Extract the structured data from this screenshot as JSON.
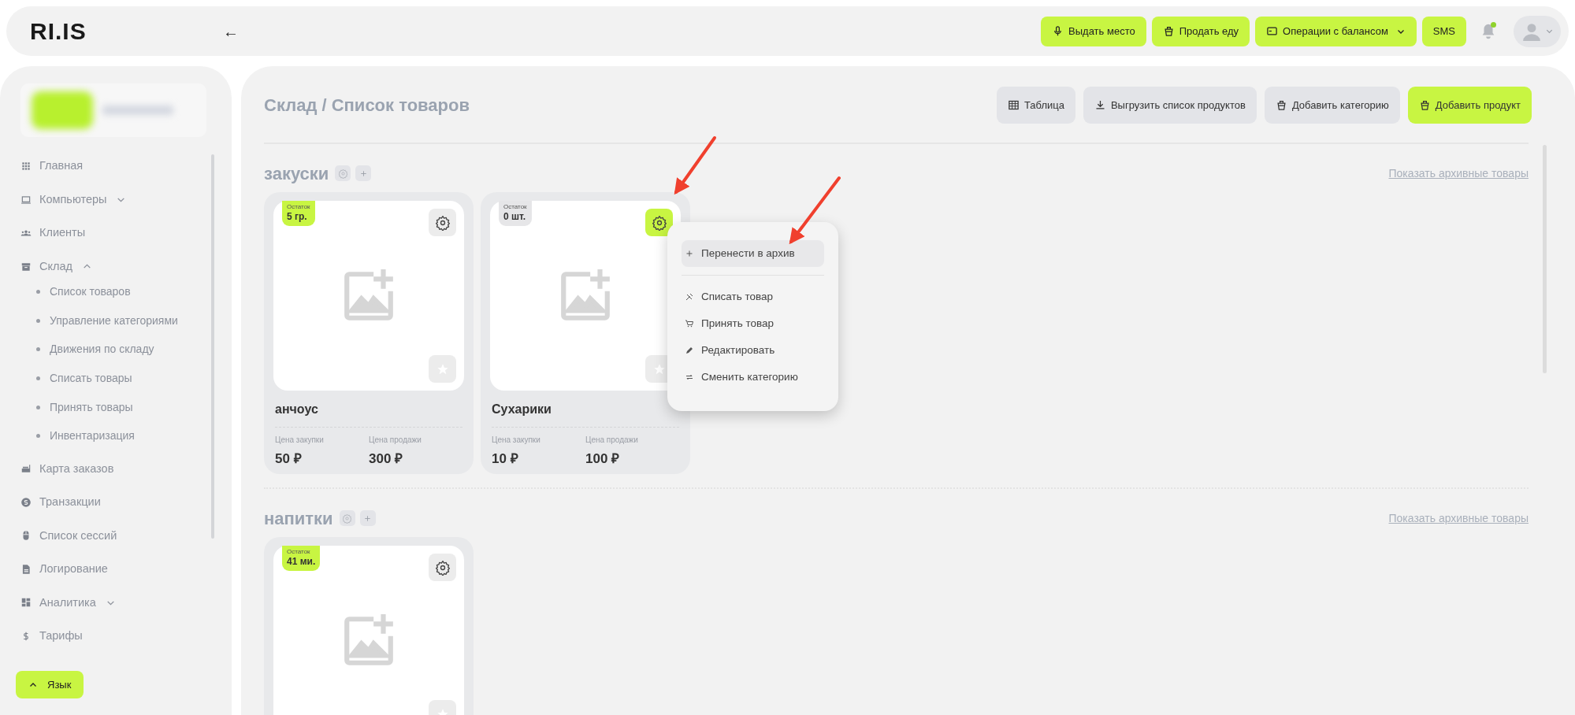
{
  "topbar": {
    "logo": "RI.IS",
    "back": "←",
    "actions": [
      {
        "label": "Выдать место",
        "kind": "mic",
        "caret": false
      },
      {
        "label": "Продать еду",
        "kind": "cup",
        "caret": false
      },
      {
        "label": "Операции с балансом",
        "kind": "card",
        "caret": true
      },
      {
        "label": "SMS",
        "kind": "text",
        "caret": false
      }
    ],
    "has_notification": true
  },
  "sidebar": {
    "nav": [
      {
        "label": "Главная",
        "kind": "grid"
      },
      {
        "label": "Компьютеры",
        "kind": "laptop",
        "expanded": false
      },
      {
        "label": "Клиенты",
        "kind": "users"
      },
      {
        "label": "Склад",
        "kind": "box",
        "expanded": true,
        "children": [
          {
            "label": "Список товаров"
          },
          {
            "label": "Управление категориями"
          },
          {
            "label": "Движения по складу"
          },
          {
            "label": "Списать товары"
          },
          {
            "label": "Принять товары"
          },
          {
            "label": "Инвентаризация"
          }
        ]
      },
      {
        "label": "Карта заказов",
        "kind": "orders"
      },
      {
        "label": "Транзакции",
        "kind": "coin"
      },
      {
        "label": "Список сессий",
        "kind": "mouse"
      },
      {
        "label": "Логирование",
        "kind": "doc"
      },
      {
        "label": "Аналитика",
        "kind": "dash",
        "expanded": false
      },
      {
        "label": "Тарифы",
        "kind": "dollar"
      }
    ],
    "language_button": "Язык"
  },
  "main": {
    "breadcrumb": "Склад / Список товаров",
    "toolbar": [
      {
        "label": "Таблица",
        "kind": "table",
        "primary": false
      },
      {
        "label": "Выгрузить список продуктов",
        "kind": "download",
        "primary": false
      },
      {
        "label": "Добавить категорию",
        "kind": "cup",
        "primary": false
      },
      {
        "label": "Добавить продукт",
        "kind": "cup",
        "primary": true
      }
    ],
    "categories": [
      {
        "name": "закуски",
        "archive_link": "Показать архивные товары",
        "products": [
          {
            "stock_label": "Остаток",
            "stock": "5 гр.",
            "in_stock": true,
            "menu_open": false,
            "name": "анчоус",
            "purchase_label": "Цена закупки",
            "purchase": "50 ₽",
            "sale_label": "Цена продажи",
            "sale": "300 ₽"
          },
          {
            "stock_label": "Остаток",
            "stock": "0 шт.",
            "in_stock": false,
            "menu_open": true,
            "name": "Сухарики",
            "purchase_label": "Цена закупки",
            "purchase": "10 ₽",
            "sale_label": "Цена продажи",
            "sale": "100 ₽"
          }
        ]
      },
      {
        "name": "напитки",
        "archive_link": "Показать архивные товары",
        "products": [
          {
            "stock_label": "Остаток",
            "stock": "41 ми.",
            "in_stock": true,
            "menu_open": false
          }
        ]
      }
    ],
    "context_menu": {
      "items": [
        {
          "label": "Перенести в архив",
          "kind": "plus",
          "highlighted": true
        },
        {
          "label": "Списать товар",
          "kind": "writeoff",
          "highlighted": false
        },
        {
          "label": "Принять товар",
          "kind": "cart",
          "highlighted": false
        },
        {
          "label": "Редактировать",
          "kind": "pencil",
          "highlighted": false
        },
        {
          "label": "Сменить категорию",
          "kind": "swap",
          "highlighted": false
        }
      ]
    },
    "annotations": [
      {
        "kind": "arrow"
      },
      {
        "kind": "arrow"
      }
    ]
  }
}
